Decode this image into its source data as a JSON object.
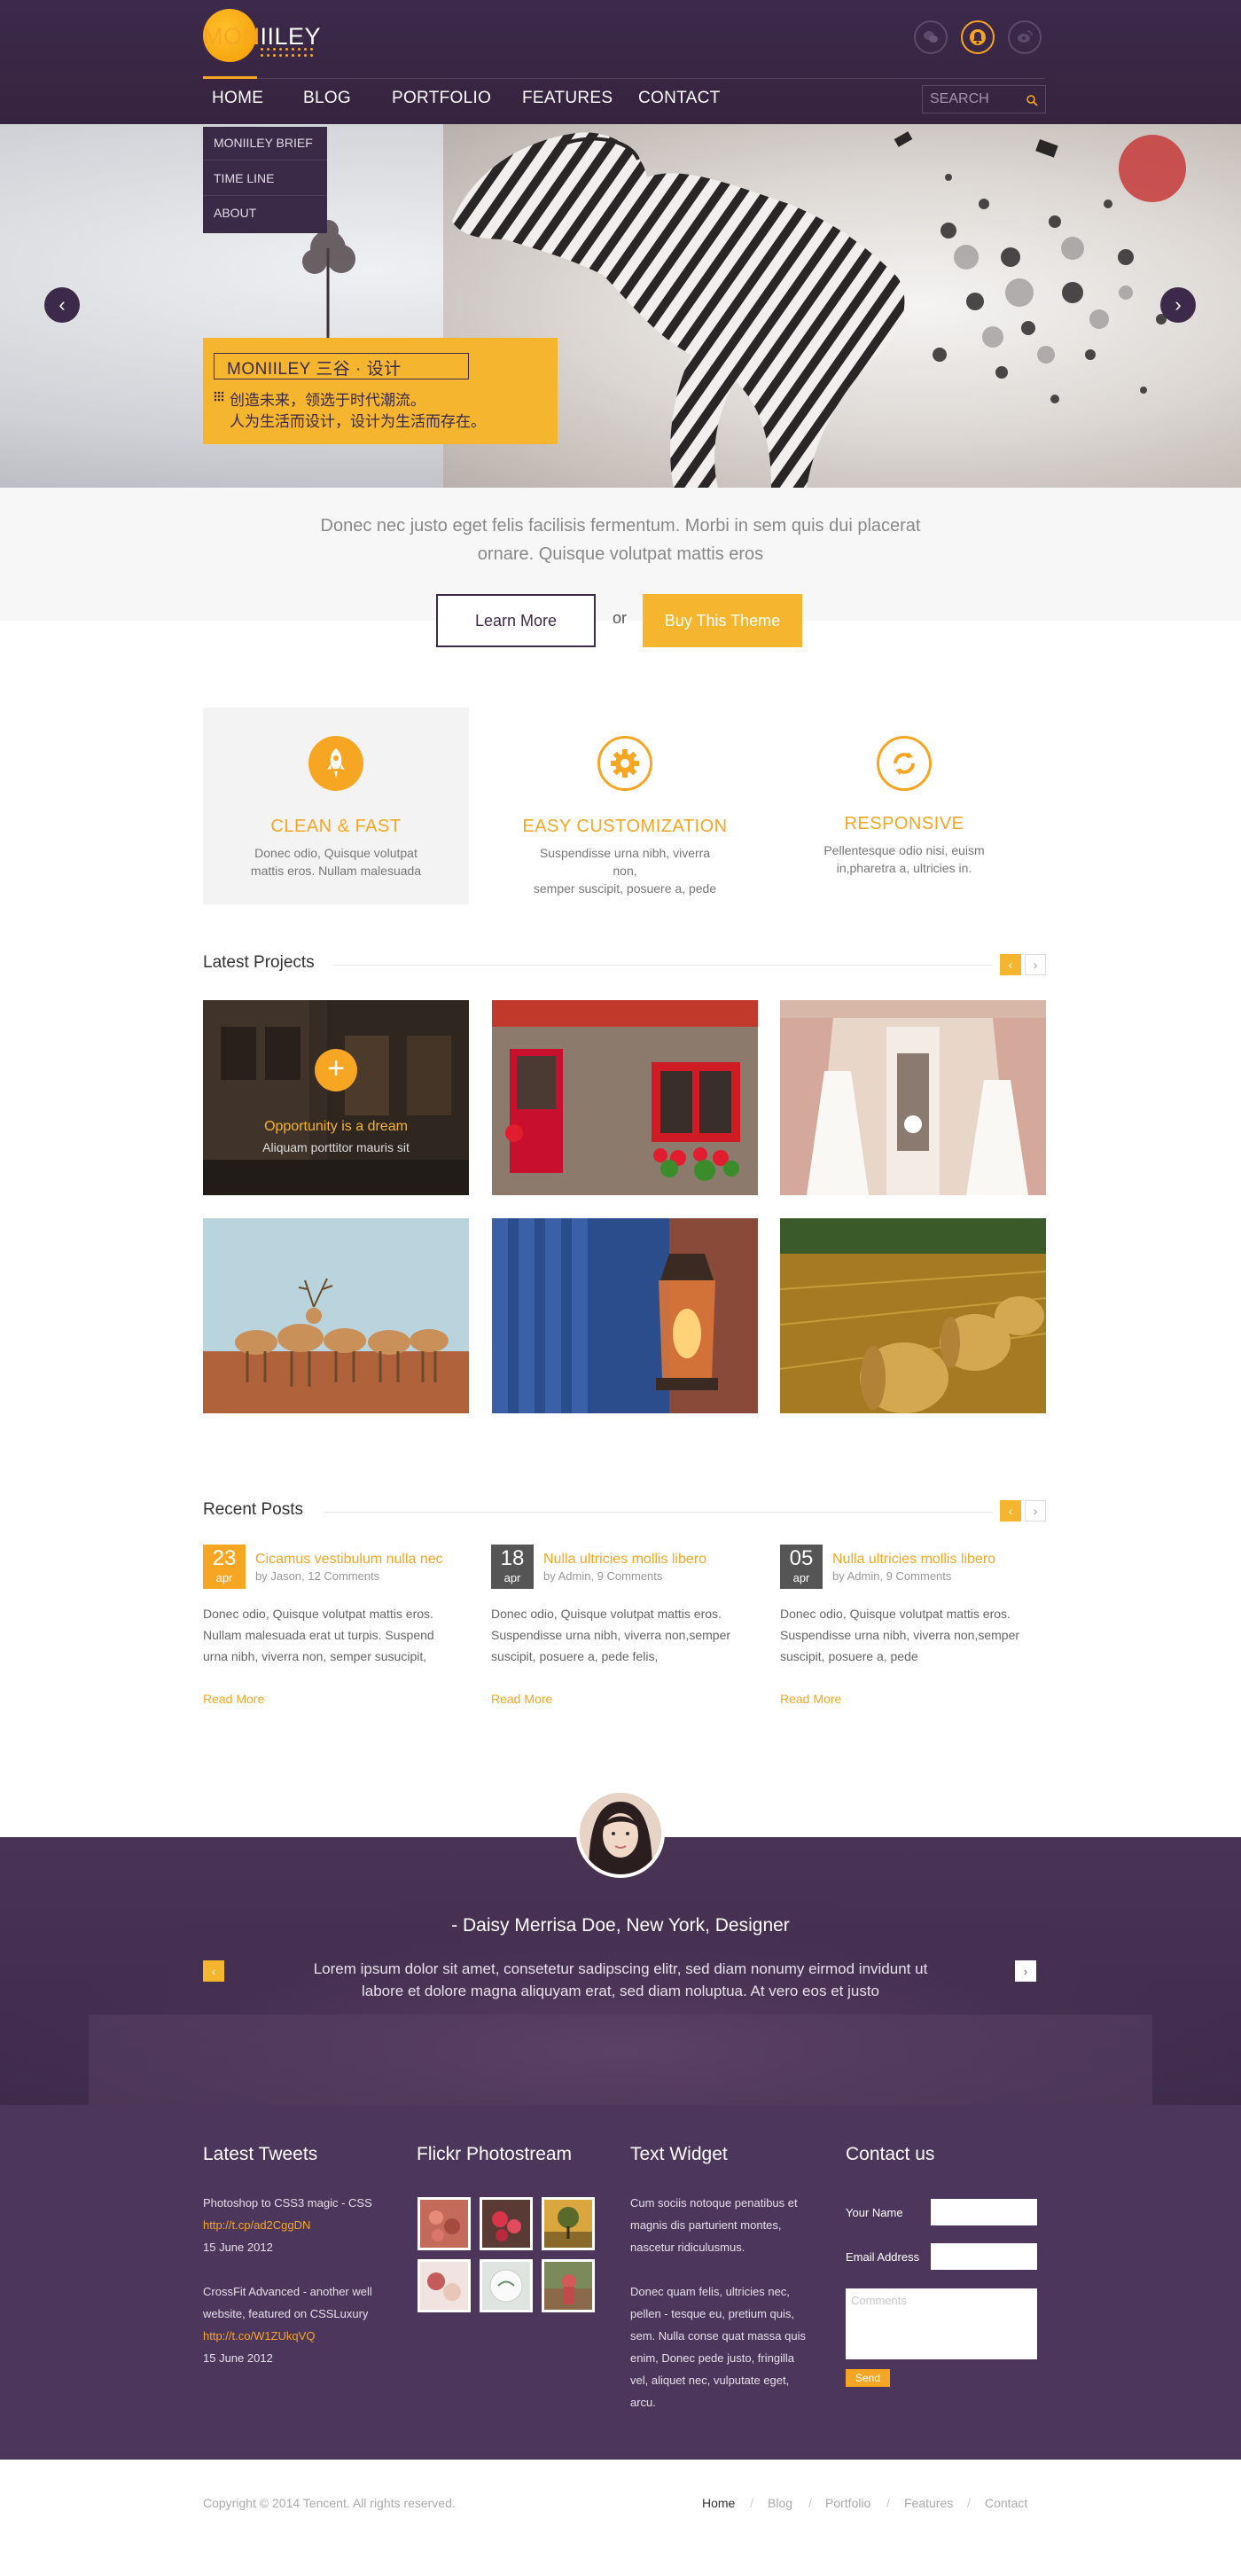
{
  "brand": {
    "logo_prefix": "MON",
    "logo_suffix": "IILEY"
  },
  "nav": {
    "items": [
      "HOME",
      "BLOG",
      "PORTFOLIO",
      "FEATURES",
      "CONTACT"
    ],
    "active": "HOME",
    "search_placeholder": "SEARCH"
  },
  "header_icons": [
    "wechat-icon",
    "bell-icon",
    "weibo-icon"
  ],
  "dropdown": {
    "items": [
      "MONIILEY BRIEF",
      "TIME LINE",
      "ABOUT"
    ]
  },
  "hero": {
    "caption_title": "MONIILEY 三谷 · 设计",
    "caption_line1": "创造未来，领选于时代潮流。",
    "caption_line2": "人为生活而设计，设计为生活而存在。",
    "prev_label": "‹",
    "next_label": "›"
  },
  "intro": {
    "line1": "Donec nec justo eget felis facilisis fermentum. Morbi in sem quis dui placerat",
    "line2": "ornare. Quisque volutpat mattis eros",
    "learn_more": "Learn More",
    "or": "or",
    "buy": "Buy This Theme"
  },
  "features": [
    {
      "title": "CLEAN & FAST",
      "desc1": "Donec odio, Quisque volutpat",
      "desc2": "mattis eros. Nullam malesuada"
    },
    {
      "title": "EASY CUSTOMIZATION",
      "desc1": "Suspendisse urna nibh, viverra non,",
      "desc2": "semper suscipit, posuere a, pede"
    },
    {
      "title": "RESPONSIVE",
      "desc1": "Pellentesque odio nisi, euism",
      "desc2": "in,pharetra a, ultricies in."
    }
  ],
  "projects": {
    "title": "Latest Projects",
    "hover_caption": "Opportunity is a dream",
    "hover_sub": "Aliquam porttitor mauris sit",
    "plus": "+"
  },
  "posts": {
    "title": "Recent Posts",
    "items": [
      {
        "day": "23",
        "month": "apr",
        "title": "Cicamus vestibulum nulla nec",
        "meta": "by Jason, 12 Comments",
        "body1": "Donec odio, Quisque volutpat mattis eros.",
        "body2": "Nullam malesuada erat ut turpis. Suspend",
        "body3": "urna nibh, viverra non, semper susucipit,",
        "read_more": "Read More",
        "date_color": "#f6a623"
      },
      {
        "day": "18",
        "month": "apr",
        "title": "Nulla ultricies mollis libero",
        "meta": "by Admin, 9 Comments",
        "body1": "Donec odio, Quisque volutpat mattis eros.",
        "body2": "Suspendisse urna nibh, viverra non,semper",
        "body3": "suscipit, posuere a, pede felis,",
        "read_more": "Read More",
        "date_color": "#555555"
      },
      {
        "day": "05",
        "month": "apr",
        "title": "Nulla ultricies mollis libero",
        "meta": "by Admin, 9 Comments",
        "body1": "Donec odio, Quisque volutpat mattis eros.",
        "body2": "Suspendisse urna nibh, viverra non,semper",
        "body3": "suscipit, posuere a, pede",
        "read_more": "Read More",
        "date_color": "#555555"
      }
    ]
  },
  "testimonial": {
    "name": "- Daisy Merrisa Doe, New York, Designer",
    "quote1": "Lorem ipsum dolor sit amet, consetetur sadipscing elitr, sed diam nonumy eirmod invidunt ut",
    "quote2": "labore et dolore magna aliquyam erat, sed diam noluptua. At vero eos et justo",
    "prev": "‹",
    "next": "›"
  },
  "footer": {
    "tweets": {
      "title": "Latest Tweets",
      "t1_text": "Photoshop to CSS3 magic - CSS",
      "t1_link": "http://t.cp/ad2CggDN",
      "t1_date": "15 June 2012",
      "t2_text1": "CrossFit Advanced - another well",
      "t2_text2": "website, featured on CSSLuxury",
      "t2_link": "http://t.co/W1ZUkqVQ",
      "t2_date": "15 June 2012"
    },
    "flickr": {
      "title": "Flickr Photostream"
    },
    "widget": {
      "title": "Text Widget",
      "p1": [
        "Cum sociis notoque penatibus et",
        "magnis dis parturient montes,",
        "nascetur ridiculusmus."
      ],
      "p2": [
        "Donec quam felis, ultricies nec,",
        "pellen - tesque eu, pretium quis,",
        "sem. Nulla conse quat massa quis",
        "enim, Donec pede justo, fringilla",
        "vel, aliquet nec, vulputate eget,",
        "arcu."
      ]
    },
    "contact": {
      "title": "Contact us",
      "name_label": "Your Name",
      "email_label": "Email Address",
      "comment_placeholder": "Comments",
      "send": "Send"
    }
  },
  "bottom": {
    "copyright": "Copyright © 2014 Tencent. All rights reserved.",
    "links": [
      "Home",
      "Blog",
      "Portfolio",
      "Features",
      "Contact"
    ],
    "separator": "/"
  },
  "colors": {
    "accent": "#f6a623",
    "brand_purple": "#3d2a4b",
    "footer_purple": "#4d365c"
  }
}
